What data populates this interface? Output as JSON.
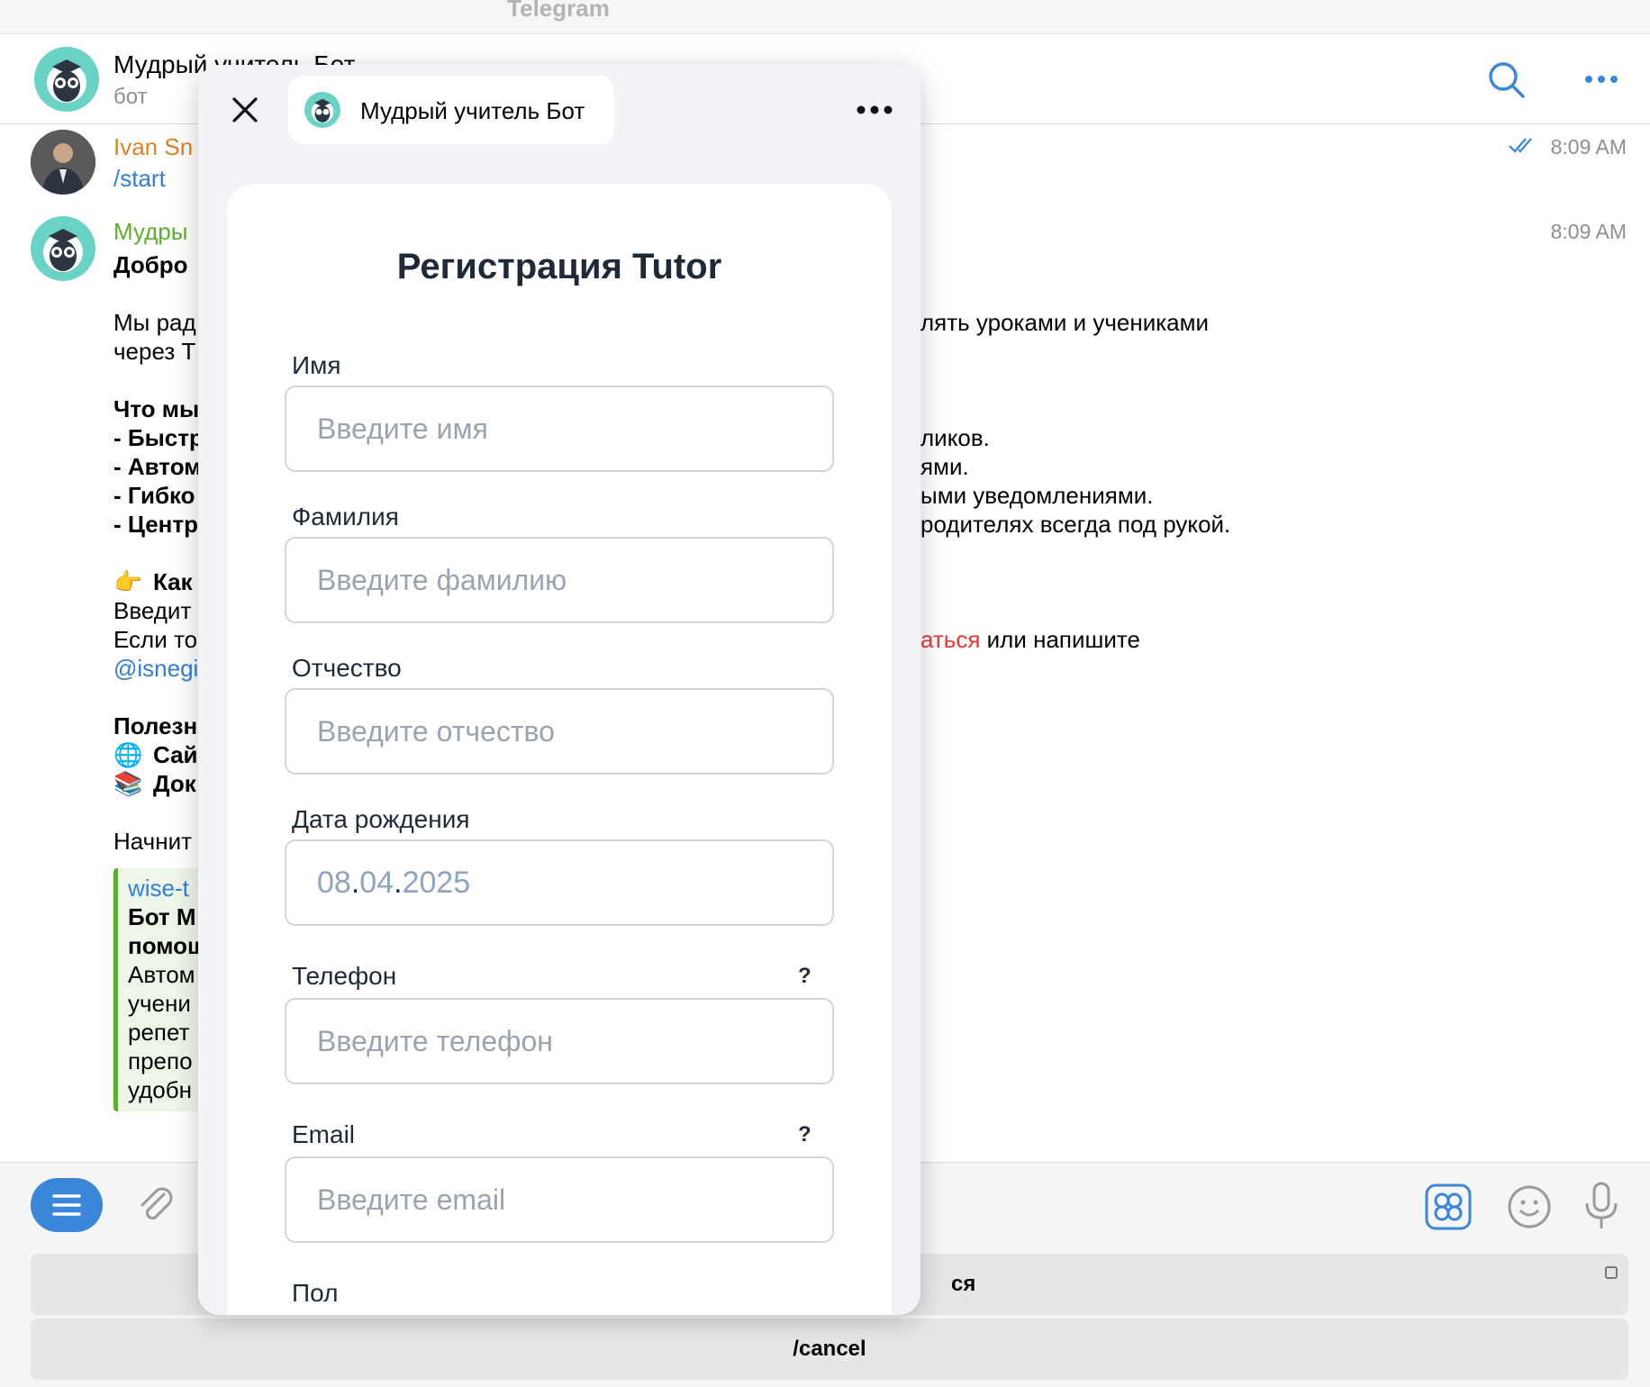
{
  "app": {
    "title": "Telegram"
  },
  "chat": {
    "title": "Мудрый учитель Бот",
    "subtitle": "бот"
  },
  "messages": {
    "user": {
      "name": "Ivan Sn",
      "text": "/start",
      "time": "8:09 AM"
    },
    "bot": {
      "name": "Мудры",
      "time": "8:09 AM",
      "left": {
        "greeting": "Добро",
        "l1": "Мы рад",
        "l2": "через Т",
        "what": "Что мы",
        "b1": "- Быстр",
        "b2": "- Автом",
        "b3": "- Гибко",
        "b4": "- Центр",
        "how_emoji": "👉",
        "how": "Как",
        "enter": "Введит",
        "if": "Если то",
        "handle": "@isnegi",
        "useful": "Полезн",
        "site_emoji": "🌐",
        "site": "Сай",
        "docs_emoji": "📚",
        "docs": "Док",
        "start": "Начнит"
      },
      "right": {
        "r1": "лять уроками и учениками",
        "r2": "ликов.",
        "r3": "ями.",
        "r4": "ыми уведомлениями.",
        "r5": "родителях всегда под рукой.",
        "r6_red": "аться",
        "r6": " или напишите"
      },
      "quote": {
        "site": "wise-t",
        "l1": "Бот М",
        "l2": "помощ",
        "l3": "Автом",
        "l4": "учени",
        "l5": "репет",
        "l6": "препо",
        "l7": "удобн"
      }
    }
  },
  "keyboard": {
    "btn1_tail": "ся",
    "btn2": "/cancel"
  },
  "webapp": {
    "title": "Мудрый учитель Бот",
    "form_title": "Регистрация Tutor",
    "fields": {
      "first_name": {
        "label": "Имя",
        "placeholder": "Введите имя"
      },
      "last_name": {
        "label": "Фамилия",
        "placeholder": "Введите фамилию"
      },
      "patronymic": {
        "label": "Отчество",
        "placeholder": "Введите отчество"
      },
      "birth": {
        "label": "Дата рождения",
        "d": "08",
        "m": "04",
        "y": "2025",
        "sep": "."
      },
      "phone": {
        "label": "Телефон",
        "help": "?",
        "placeholder": "Введите телефон"
      },
      "email": {
        "label": "Email",
        "help": "?",
        "placeholder": "Введите email"
      },
      "gender": {
        "label": "Пол"
      }
    }
  },
  "colors": {
    "accent": "#3a86d8",
    "username": "#d9822b",
    "botname": "#5bb02e",
    "red_link": "#e53935"
  }
}
